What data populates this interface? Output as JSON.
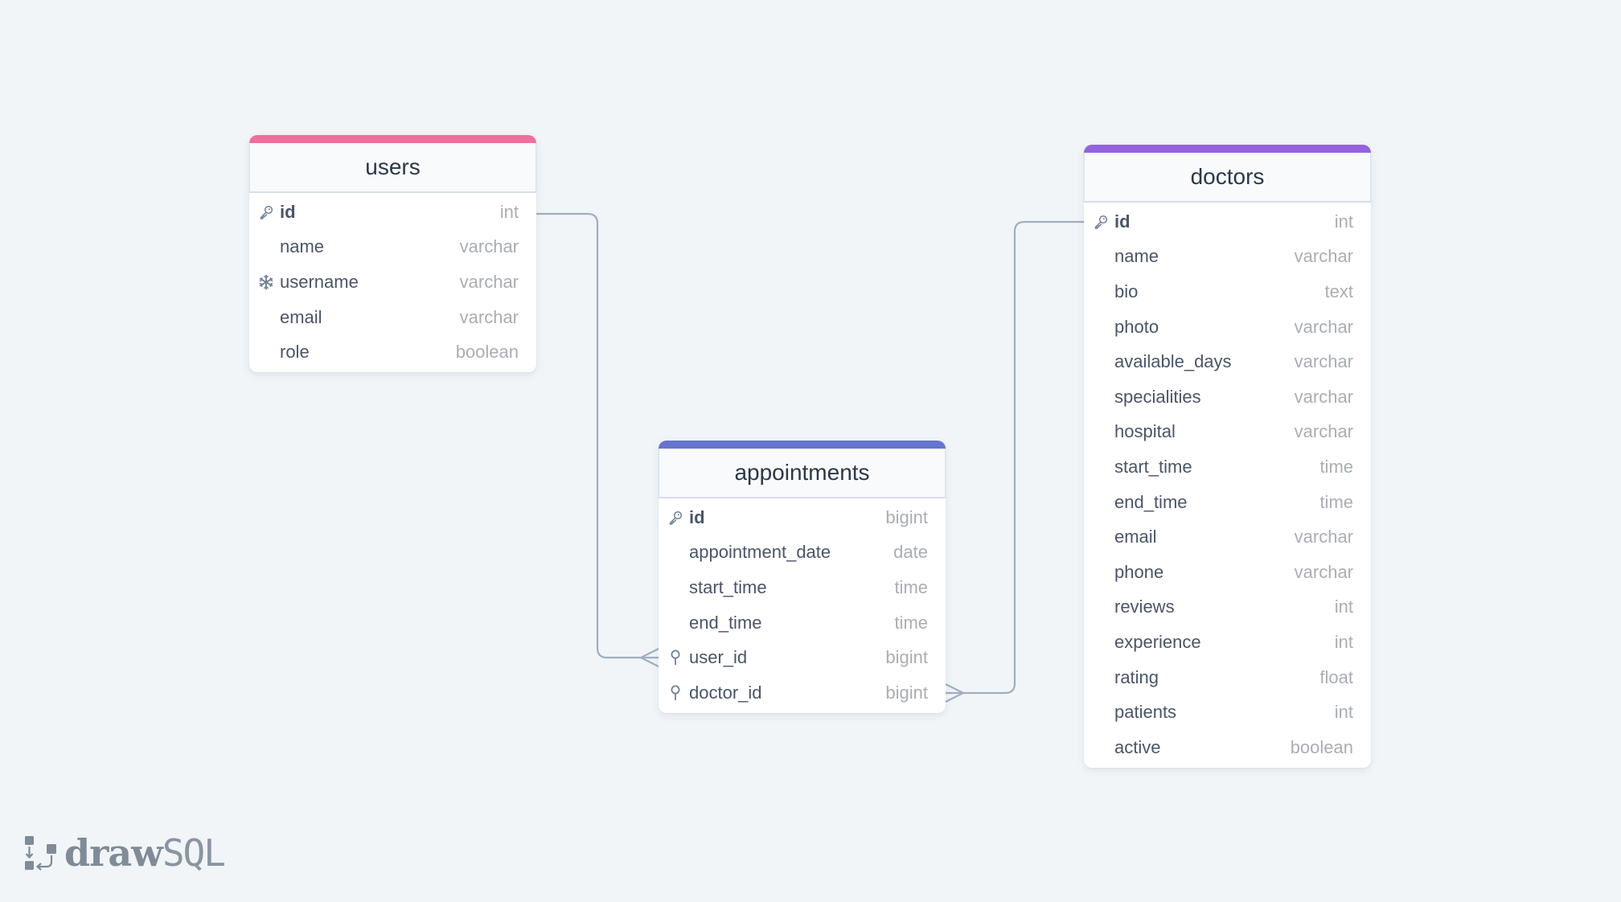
{
  "app": {
    "logo_primary": "draw",
    "logo_secondary": "SQL"
  },
  "colors": {
    "background": "#f1f5f8",
    "connector": "#a0aec0",
    "users_accent": "#f06e9b",
    "appointments_accent": "#6674cd",
    "doctors_accent": "#9563de"
  },
  "tables": {
    "users": {
      "name": "users",
      "columns": [
        {
          "name": "id",
          "type": "int",
          "icon": "key-icon",
          "primary": true
        },
        {
          "name": "name",
          "type": "varchar",
          "icon": "",
          "primary": false
        },
        {
          "name": "username",
          "type": "varchar",
          "icon": "snowflake-icon",
          "primary": false
        },
        {
          "name": "email",
          "type": "varchar",
          "icon": "",
          "primary": false
        },
        {
          "name": "role",
          "type": "boolean",
          "icon": "",
          "primary": false
        }
      ]
    },
    "appointments": {
      "name": "appointments",
      "columns": [
        {
          "name": "id",
          "type": "bigint",
          "icon": "key-icon",
          "primary": true
        },
        {
          "name": "appointment_date",
          "type": "date",
          "icon": "",
          "primary": false
        },
        {
          "name": "start_time",
          "type": "time",
          "icon": "",
          "primary": false
        },
        {
          "name": "end_time",
          "type": "time",
          "icon": "",
          "primary": false
        },
        {
          "name": "user_id",
          "type": "bigint",
          "icon": "pin-icon",
          "primary": false
        },
        {
          "name": "doctor_id",
          "type": "bigint",
          "icon": "pin-icon",
          "primary": false
        }
      ]
    },
    "doctors": {
      "name": "doctors",
      "columns": [
        {
          "name": "id",
          "type": "int",
          "icon": "key-icon",
          "primary": true
        },
        {
          "name": "name",
          "type": "varchar",
          "icon": "",
          "primary": false
        },
        {
          "name": "bio",
          "type": "text",
          "icon": "",
          "primary": false
        },
        {
          "name": "photo",
          "type": "varchar",
          "icon": "",
          "primary": false
        },
        {
          "name": "available_days",
          "type": "varchar",
          "icon": "",
          "primary": false
        },
        {
          "name": "specialities",
          "type": "varchar",
          "icon": "",
          "primary": false
        },
        {
          "name": "hospital",
          "type": "varchar",
          "icon": "",
          "primary": false
        },
        {
          "name": "start_time",
          "type": "time",
          "icon": "",
          "primary": false
        },
        {
          "name": "end_time",
          "type": "time",
          "icon": "",
          "primary": false
        },
        {
          "name": "email",
          "type": "varchar",
          "icon": "",
          "primary": false
        },
        {
          "name": "phone",
          "type": "varchar",
          "icon": "",
          "primary": false
        },
        {
          "name": "reviews",
          "type": "int",
          "icon": "",
          "primary": false
        },
        {
          "name": "experience",
          "type": "int",
          "icon": "",
          "primary": false
        },
        {
          "name": "rating",
          "type": "float",
          "icon": "",
          "primary": false
        },
        {
          "name": "patients",
          "type": "int",
          "icon": "",
          "primary": false
        },
        {
          "name": "active",
          "type": "boolean",
          "icon": "",
          "primary": false
        }
      ]
    }
  },
  "relationships": [
    {
      "from_table": "users",
      "from_column": "id",
      "to_table": "appointments",
      "to_column": "user_id",
      "cardinality": "one-to-many"
    },
    {
      "from_table": "doctors",
      "from_column": "id",
      "to_table": "appointments",
      "to_column": "doctor_id",
      "cardinality": "one-to-many"
    }
  ]
}
